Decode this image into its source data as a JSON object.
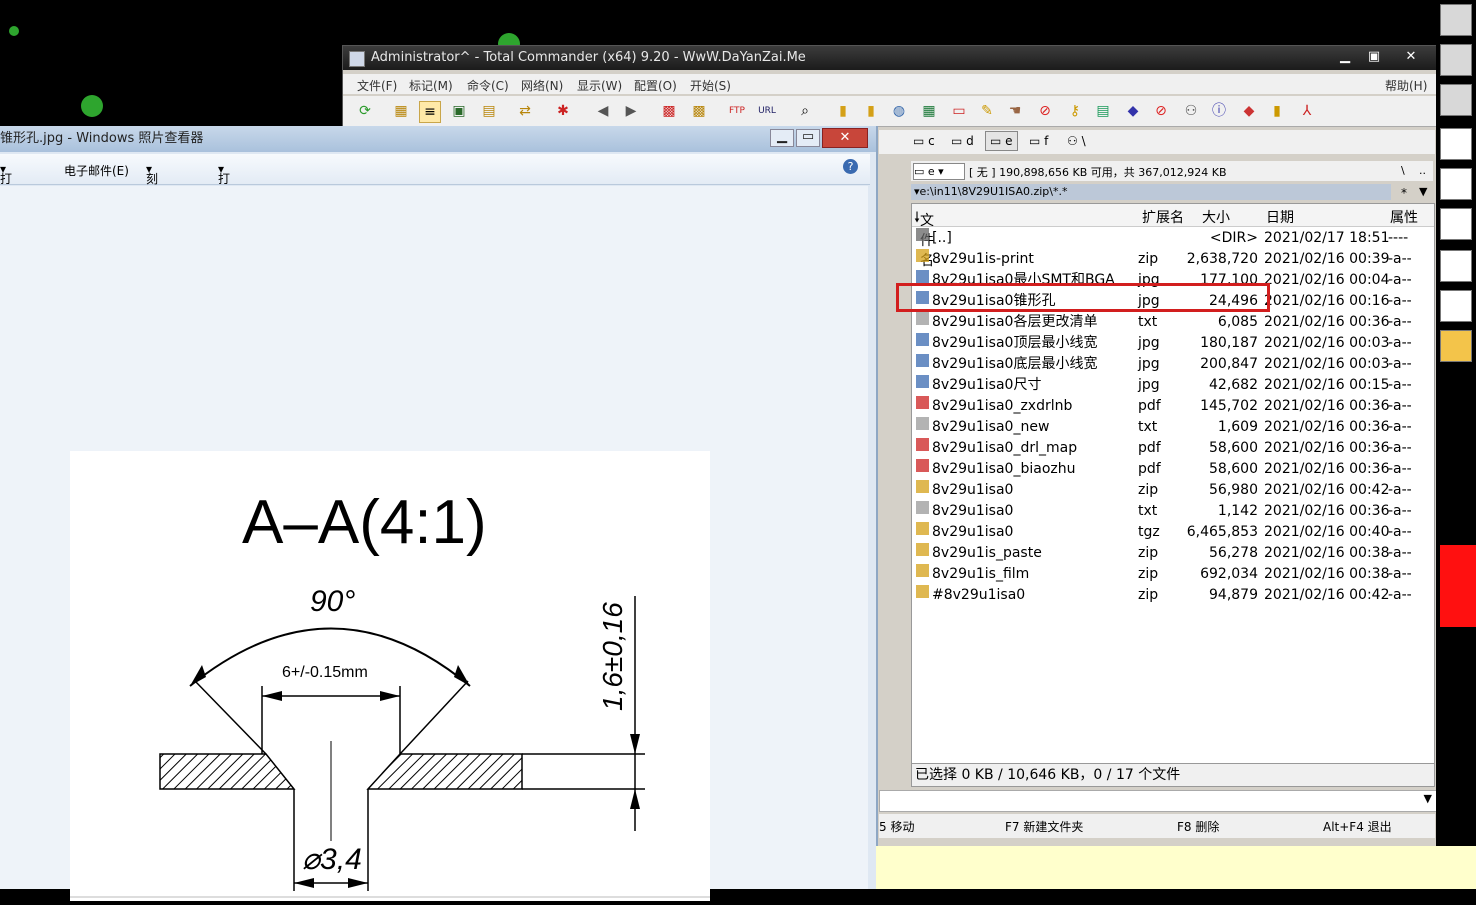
{
  "tc": {
    "title": "Administrator^ - Total Commander (x64) 9.20 - WwW.DaYanZai.Me",
    "menu": [
      "文件(F)",
      "标记(M)",
      "命令(C)",
      "网络(N)",
      "显示(W)",
      "配置(O)",
      "开始(S)"
    ],
    "help": "帮助(H)",
    "drives": [
      "c",
      "d",
      "e",
      "f",
      "\\"
    ],
    "drive_select": "e",
    "drive_info": "[ 无 ] 190,898,656 KB 可用，共 367,012,924 KB",
    "drive_nav": [
      "\\",
      ".."
    ],
    "path": "e:\\in11\\8V29U1ISA0.zip\\*.*",
    "path_filter": "*",
    "columns": [
      "文件名",
      "扩展名",
      "大小",
      "日期",
      "属性"
    ],
    "files": [
      {
        "name": "[..]",
        "ext": "",
        "size": "<DIR>",
        "date": "2021/02/17 18:51",
        "attr": "----",
        "icon": "up-icon"
      },
      {
        "name": "8v29u1is-print",
        "ext": "zip",
        "size": "2,638,720",
        "date": "2021/02/16 00:39",
        "attr": "-a--",
        "icon": "zip-icon"
      },
      {
        "name": "8v29u1isa0最小SMT和BGA",
        "ext": "jpg",
        "size": "177,100",
        "date": "2021/02/16 00:04",
        "attr": "-a--",
        "icon": "image-icon"
      },
      {
        "name": "8v29u1isa0锥形孔",
        "ext": "jpg",
        "size": "24,496",
        "date": "2021/02/16 00:16",
        "attr": "-a--",
        "icon": "image-icon"
      },
      {
        "name": "8v29u1isa0各层更改清单",
        "ext": "txt",
        "size": "6,085",
        "date": "2021/02/16 00:36",
        "attr": "-a--",
        "icon": "text-icon"
      },
      {
        "name": "8v29u1isa0顶层最小线宽",
        "ext": "jpg",
        "size": "180,187",
        "date": "2021/02/16 00:03",
        "attr": "-a--",
        "icon": "image-icon"
      },
      {
        "name": "8v29u1isa0底层最小线宽",
        "ext": "jpg",
        "size": "200,847",
        "date": "2021/02/16 00:03",
        "attr": "-a--",
        "icon": "image-icon"
      },
      {
        "name": "8v29u1isa0尺寸",
        "ext": "jpg",
        "size": "42,682",
        "date": "2021/02/16 00:15",
        "attr": "-a--",
        "icon": "image-icon"
      },
      {
        "name": "8v29u1isa0_zxdrlnb",
        "ext": "pdf",
        "size": "145,702",
        "date": "2021/02/16 00:36",
        "attr": "-a--",
        "icon": "pdf-icon"
      },
      {
        "name": "8v29u1isa0_new",
        "ext": "txt",
        "size": "1,609",
        "date": "2021/02/16 00:36",
        "attr": "-a--",
        "icon": "text-icon"
      },
      {
        "name": "8v29u1isa0_drl_map",
        "ext": "pdf",
        "size": "58,600",
        "date": "2021/02/16 00:36",
        "attr": "-a--",
        "icon": "pdf-icon"
      },
      {
        "name": "8v29u1isa0_biaozhu",
        "ext": "pdf",
        "size": "58,600",
        "date": "2021/02/16 00:36",
        "attr": "-a--",
        "icon": "pdf-icon"
      },
      {
        "name": "8v29u1isa0",
        "ext": "zip",
        "size": "56,980",
        "date": "2021/02/16 00:42",
        "attr": "-a--",
        "icon": "zip-icon"
      },
      {
        "name": "8v29u1isa0",
        "ext": "txt",
        "size": "1,142",
        "date": "2021/02/16 00:36",
        "attr": "-a--",
        "icon": "text-icon"
      },
      {
        "name": "8v29u1isa0",
        "ext": "tgz",
        "size": "6,465,853",
        "date": "2021/02/16 00:40",
        "attr": "-a--",
        "icon": "zip-icon"
      },
      {
        "name": "8v29u1is_paste",
        "ext": "zip",
        "size": "56,278",
        "date": "2021/02/16 00:38",
        "attr": "-a--",
        "icon": "zip-icon"
      },
      {
        "name": "8v29u1is_film",
        "ext": "zip",
        "size": "692,034",
        "date": "2021/02/16 00:38",
        "attr": "-a--",
        "icon": "zip-icon"
      },
      {
        "name": "#8v29u1isa0",
        "ext": "zip",
        "size": "94,879",
        "date": "2021/02/16 00:42",
        "attr": "-a--",
        "icon": "zip-icon"
      }
    ],
    "status": "已选择 0 KB / 10,646 KB，0 / 17 个文件",
    "fkeys": [
      "5 移动",
      "F7 新建文件夹",
      "F8 删除",
      "Alt+F4 退出"
    ]
  },
  "viewer": {
    "title": "锥形孔.jpg - Windows 照片查看器",
    "toolbar": [
      "打印(P)",
      "电子邮件(E)",
      "刻录(U)",
      "打开(O)"
    ],
    "drawing": {
      "section_label": "A–A(4:1)",
      "angle_label": "90°",
      "dimension_label": "6+/-0.15mm",
      "depth_label": "1,6±0,16",
      "hole_label": "⌀3,4"
    }
  }
}
